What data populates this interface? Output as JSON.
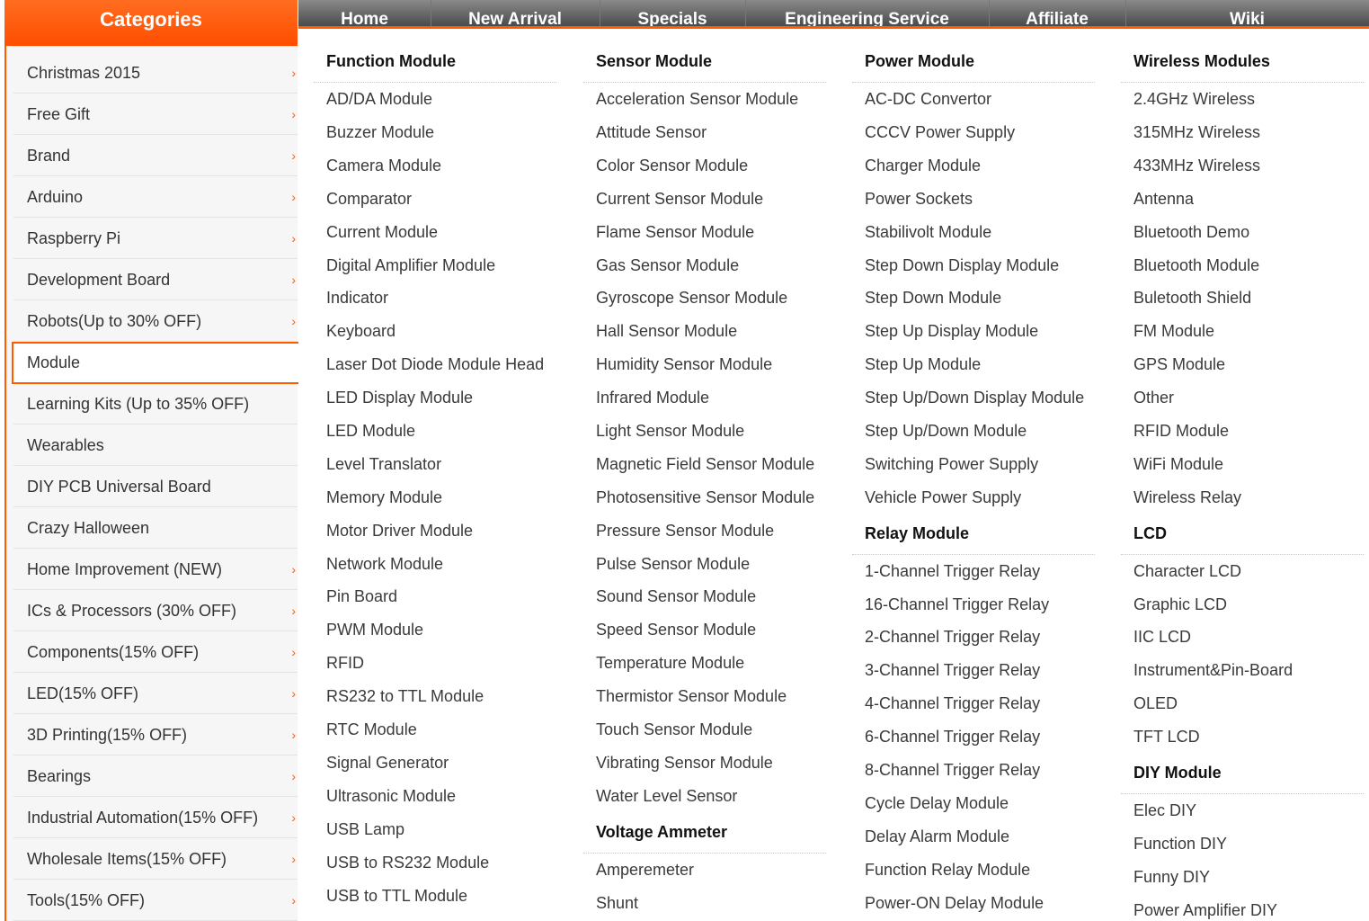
{
  "nav": {
    "items": [
      "Home",
      "New Arrival",
      "Specials",
      "Engineering Service",
      "Affiliate",
      "Wiki"
    ]
  },
  "sidebar": {
    "title": "Categories",
    "arrow_glyph": "›",
    "active_index": 7,
    "items": [
      {
        "label": "Christmas 2015",
        "arrow": true
      },
      {
        "label": "Free Gift",
        "arrow": true
      },
      {
        "label": "Brand",
        "arrow": true
      },
      {
        "label": "Arduino",
        "arrow": true
      },
      {
        "label": "Raspberry Pi",
        "arrow": true
      },
      {
        "label": "Development Board",
        "arrow": true
      },
      {
        "label": "Robots(Up to 30% OFF)",
        "arrow": true
      },
      {
        "label": "Module",
        "arrow": false
      },
      {
        "label": "Learning Kits (Up to 35% OFF)",
        "arrow": false
      },
      {
        "label": "Wearables",
        "arrow": false
      },
      {
        "label": "DIY PCB Universal Board",
        "arrow": false
      },
      {
        "label": "Crazy Halloween",
        "arrow": false
      },
      {
        "label": "Home Improvement (NEW)",
        "arrow": true
      },
      {
        "label": "ICs & Processors (30% OFF)",
        "arrow": true
      },
      {
        "label": "Components(15% OFF)",
        "arrow": true
      },
      {
        "label": "LED(15% OFF)",
        "arrow": true
      },
      {
        "label": "3D Printing(15% OFF)",
        "arrow": true
      },
      {
        "label": "Bearings",
        "arrow": true
      },
      {
        "label": "Industrial Automation(15% OFF)",
        "arrow": true
      },
      {
        "label": "Wholesale Items(15% OFF)",
        "arrow": true
      },
      {
        "label": "Tools(15% OFF)",
        "arrow": true
      }
    ]
  },
  "menu": {
    "columns": [
      {
        "sections": [
          {
            "title": "Function Module",
            "items": [
              "AD/DA Module",
              "Buzzer Module",
              "Camera Module",
              "Comparator",
              "Current Module",
              "Digital Amplifier Module",
              "Indicator",
              "Keyboard",
              "Laser Dot Diode Module Head",
              "LED Display Module",
              "LED Module",
              "Level Translator",
              "Memory Module",
              "Motor Driver Module",
              "Network Module",
              "Pin Board",
              "PWM Module",
              "RFID",
              "RS232 to TTL Module",
              "RTC Module",
              "Signal Generator",
              "Ultrasonic Module",
              "USB Lamp",
              "USB to RS232 Module",
              "USB to TTL Module"
            ]
          }
        ]
      },
      {
        "sections": [
          {
            "title": "Sensor Module",
            "items": [
              "Acceleration Sensor Module",
              "Attitude Sensor",
              "Color Sensor Module",
              "Current Sensor Module",
              "Flame Sensor Module",
              "Gas Sensor Module",
              "Gyroscope Sensor Module",
              "Hall Sensor Module",
              "Humidity Sensor Module",
              "Infrared Module",
              "Light Sensor Module",
              "Magnetic Field Sensor Module",
              "Photosensitive Sensor Module",
              "Pressure Sensor Module",
              "Pulse Sensor Module",
              "Sound Sensor Module",
              "Speed Sensor Module",
              "Temperature Module",
              "Thermistor Sensor Module",
              "Touch Sensor Module",
              "Vibrating Sensor Module",
              "Water Level Sensor"
            ]
          },
          {
            "title": "Voltage Ammeter",
            "items": [
              "Amperemeter",
              "Shunt"
            ]
          }
        ]
      },
      {
        "sections": [
          {
            "title": "Power Module",
            "items": [
              "AC-DC Convertor",
              "CCCV Power Supply",
              "Charger Module",
              "Power Sockets",
              "Stabilivolt Module",
              "Step Down Display Module",
              "Step Down Module",
              "Step Up Display Module",
              "Step Up Module",
              "Step Up/Down Display Module",
              "Step Up/Down Module",
              "Switching Power Supply",
              "Vehicle Power Supply"
            ]
          },
          {
            "title": "Relay Module",
            "items": [
              "1-Channel Trigger Relay",
              "16-Channel Trigger Relay",
              "2-Channel Trigger Relay",
              "3-Channel Trigger Relay",
              "4-Channel Trigger Relay",
              "6-Channel Trigger Relay",
              "8-Channel Trigger Relay",
              "Cycle Delay Module",
              "Delay Alarm Module",
              "Function Relay Module",
              "Power-ON Delay Module"
            ]
          }
        ]
      },
      {
        "sections": [
          {
            "title": "Wireless Modules",
            "items": [
              "2.4GHz Wireless",
              "315MHz Wireless",
              "433MHz Wireless",
              "Antenna",
              "Bluetooth Demo",
              "Bluetooth Module",
              "Buletooth Shield",
              "FM Module",
              "GPS Module",
              "Other",
              "RFID Module",
              "WiFi Module",
              "Wireless Relay"
            ]
          },
          {
            "title": "LCD",
            "items": [
              "Character LCD",
              "Graphic LCD",
              "IIC LCD",
              "Instrument&Pin-Board",
              "OLED",
              "TFT LCD"
            ]
          },
          {
            "title": "DIY Module",
            "items": [
              "Elec DIY",
              "Function DIY",
              "Funny DIY",
              "Power Amplifier DIY"
            ]
          }
        ]
      }
    ]
  },
  "colors": {
    "accent": "#ff5a00",
    "nav_bg": "#5a5a5a",
    "sidebar_bg": "#f6f6f6"
  }
}
